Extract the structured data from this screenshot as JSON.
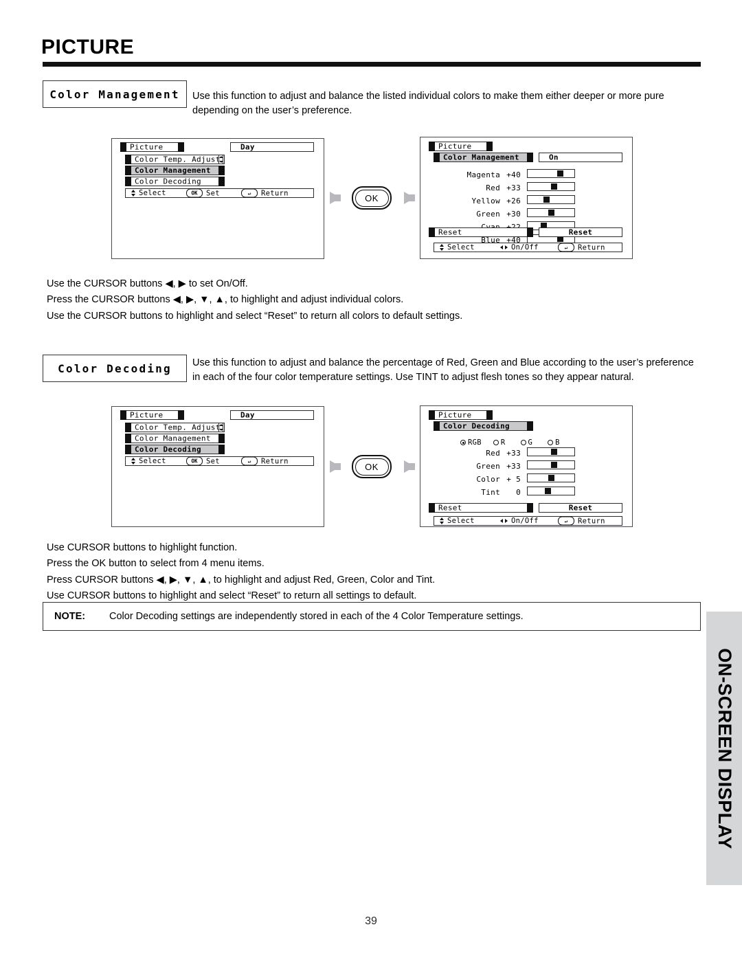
{
  "document": {
    "page_title": "PICTURE",
    "page_number": "39",
    "side_tab": "ON-SCREEN DISPLAY"
  },
  "sections": [
    {
      "heading": "Color Management",
      "description": "Use this function to adjust and balance the listed individual colors to make them either deeper or more pure depending on the user’s preference.",
      "instructions": [
        "Use the CURSOR buttons ◀, ▶ to set On/Off.",
        "Press  the CURSOR buttons ◀, ▶, ▼, ▲, to highlight and adjust individual colors.",
        "Use  the CURSOR buttons to highlight and select “Reset” to return all colors to default settings."
      ]
    },
    {
      "heading": "Color Decoding",
      "description": "Use this function to adjust and balance the percentage of Red, Green and Blue according to the user’s preference in each of the four color temperature settings.  Use TINT to adjust flesh tones so they appear natural.",
      "instructions": [
        "Use CURSOR buttons to highlight function.",
        "Press the OK button to select from 4 menu items.",
        "Press CURSOR buttons ◀, ▶, ▼, ▲, to highlight and adjust Red, Green, Color and Tint.",
        "Use CURSOR buttons to highlight and select “Reset” to return all settings to default."
      ]
    }
  ],
  "osd_menu_1": {
    "title": "Picture",
    "mode_value": "Day",
    "items": [
      {
        "label": "Color Temp. Adjust",
        "selected": false
      },
      {
        "label": "Color Management",
        "selected": true
      },
      {
        "label": "Color Decoding",
        "selected": false
      }
    ],
    "hints": {
      "select": "Select",
      "set_key": "OK",
      "set": "Set",
      "return_key": "↵",
      "return": "Return"
    }
  },
  "osd_menu_2": {
    "title": "Picture",
    "mode_value": "Day",
    "items": [
      {
        "label": "Color Temp. Adjust",
        "selected": false
      },
      {
        "label": "Color Management",
        "selected": false
      },
      {
        "label": "Color Decoding",
        "selected": true
      }
    ],
    "hints": {
      "select": "Select",
      "set_key": "OK",
      "set": "Set",
      "return_key": "↵",
      "return": "Return"
    }
  },
  "osd_color_management": {
    "title": "Picture",
    "submenu": "Color Management",
    "state_value": "On",
    "sliders": [
      {
        "label": "Magenta",
        "value": "+40",
        "pct": 70
      },
      {
        "label": "Red",
        "value": "+33",
        "pct": 58
      },
      {
        "label": "Yellow",
        "value": "+26",
        "pct": 42
      },
      {
        "label": "Green",
        "value": "+30",
        "pct": 52
      },
      {
        "label": "Cyan",
        "value": "+22",
        "pct": 36
      },
      {
        "label": "Blue",
        "value": "+40",
        "pct": 70
      }
    ],
    "reset_left": "Reset",
    "reset_right": "Reset",
    "hints": {
      "select": "Select",
      "onoff": "On/Off",
      "return_key": "↵",
      "return": "Return"
    }
  },
  "osd_color_decoding": {
    "title": "Picture",
    "submenu": "Color Decoding",
    "radios": [
      {
        "label": "RGB",
        "selected": true
      },
      {
        "label": "R",
        "selected": false
      },
      {
        "label": "G",
        "selected": false
      },
      {
        "label": "B",
        "selected": false
      }
    ],
    "sliders": [
      {
        "label": "Red",
        "value": "+33",
        "pct": 58
      },
      {
        "label": "Green",
        "value": "+33",
        "pct": 58
      },
      {
        "label": "Color",
        "value": "+ 5",
        "pct": 52
      },
      {
        "label": "Tint",
        "value": "0",
        "pct": 44
      }
    ],
    "reset_left": "Reset",
    "reset_right": "Reset",
    "hints": {
      "select": "Select",
      "onoff": "On/Off",
      "return_key": "↵",
      "return": "Return"
    }
  },
  "transition": {
    "button_label": "OK"
  },
  "note": {
    "label": "NOTE:",
    "text": "Color Decoding settings are independently stored in each of the 4 Color Temperature settings."
  }
}
